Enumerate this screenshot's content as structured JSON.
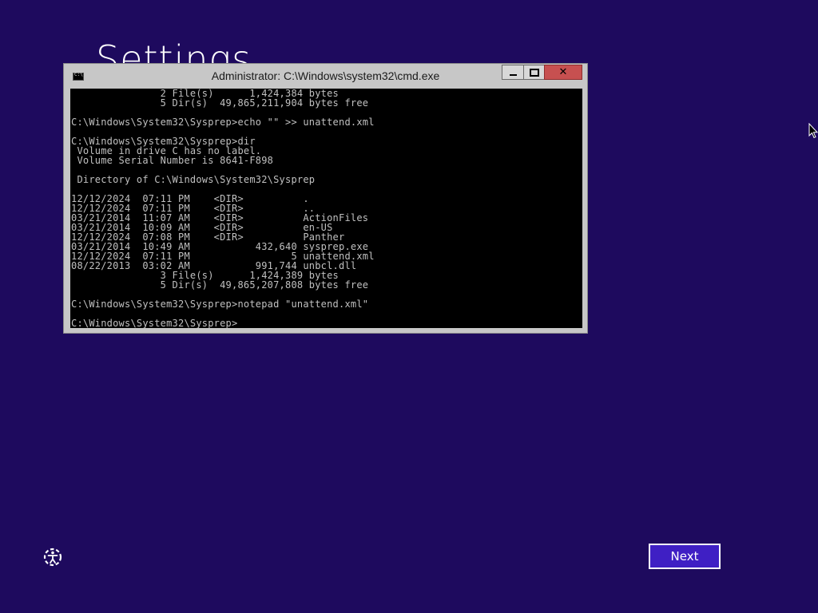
{
  "page": {
    "heading": "Settings"
  },
  "cmd_window": {
    "title": "Administrator: C:\\Windows\\system32\\cmd.exe",
    "close_glyph": "✕",
    "lines": [
      "               2 File(s)      1,424,384 bytes",
      "               5 Dir(s)  49,865,211,904 bytes free",
      "",
      "C:\\Windows\\System32\\Sysprep>echo \"\" >> unattend.xml",
      "",
      "C:\\Windows\\System32\\Sysprep>dir",
      " Volume in drive C has no label.",
      " Volume Serial Number is 8641-F898",
      "",
      " Directory of C:\\Windows\\System32\\Sysprep",
      "",
      "12/12/2024  07:11 PM    <DIR>          .",
      "12/12/2024  07:11 PM    <DIR>          ..",
      "03/21/2014  11:07 AM    <DIR>          ActionFiles",
      "03/21/2014  10:09 AM    <DIR>          en-US",
      "12/12/2024  07:08 PM    <DIR>          Panther",
      "03/21/2014  10:49 AM           432,640 sysprep.exe",
      "12/12/2024  07:11 PM                 5 unattend.xml",
      "08/22/2013  03:02 AM           991,744 unbcl.dll",
      "               3 File(s)      1,424,389 bytes",
      "               5 Dir(s)  49,865,207,808 bytes free",
      "",
      "C:\\Windows\\System32\\Sysprep>notepad \"unattend.xml\"",
      "",
      "C:\\Windows\\System32\\Sysprep>"
    ]
  },
  "footer": {
    "next_label": "Next",
    "accessibility_icon": "ease-of-access-icon"
  },
  "colors": {
    "background": "#1e0a5e",
    "next_button_fill": "#3f1fc4",
    "close_button": "#c75050",
    "console_text": "#c0c0c0"
  }
}
